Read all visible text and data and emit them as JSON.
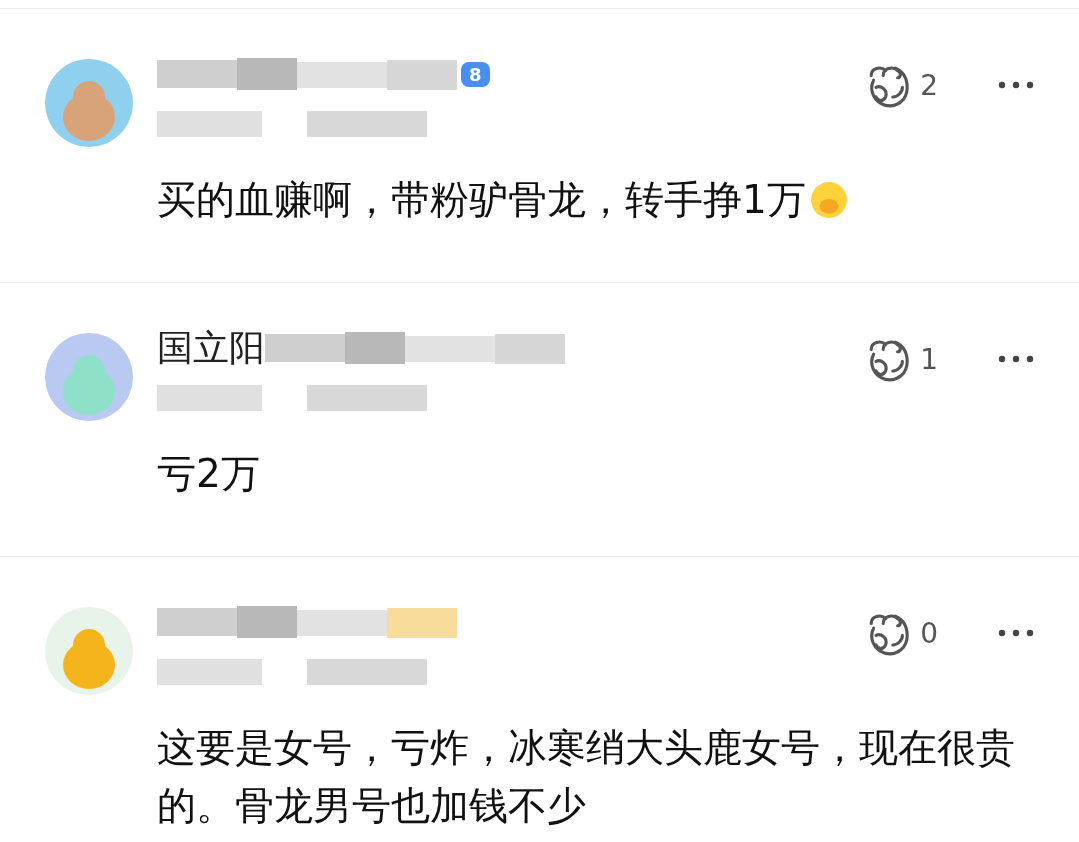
{
  "comments": [
    {
      "badge": "8",
      "likes": "2",
      "text": "买的血赚啊，带粉驴骨龙，转手挣1万",
      "emoji": true
    },
    {
      "name": "国立阳",
      "likes": "1",
      "text": "亏2万",
      "emoji": false
    },
    {
      "likes": "0",
      "text": "这要是女号，亏炸，冰寒绡大头鹿女号，现在很贵的。骨龙男号也加钱不少",
      "emoji": false
    }
  ]
}
